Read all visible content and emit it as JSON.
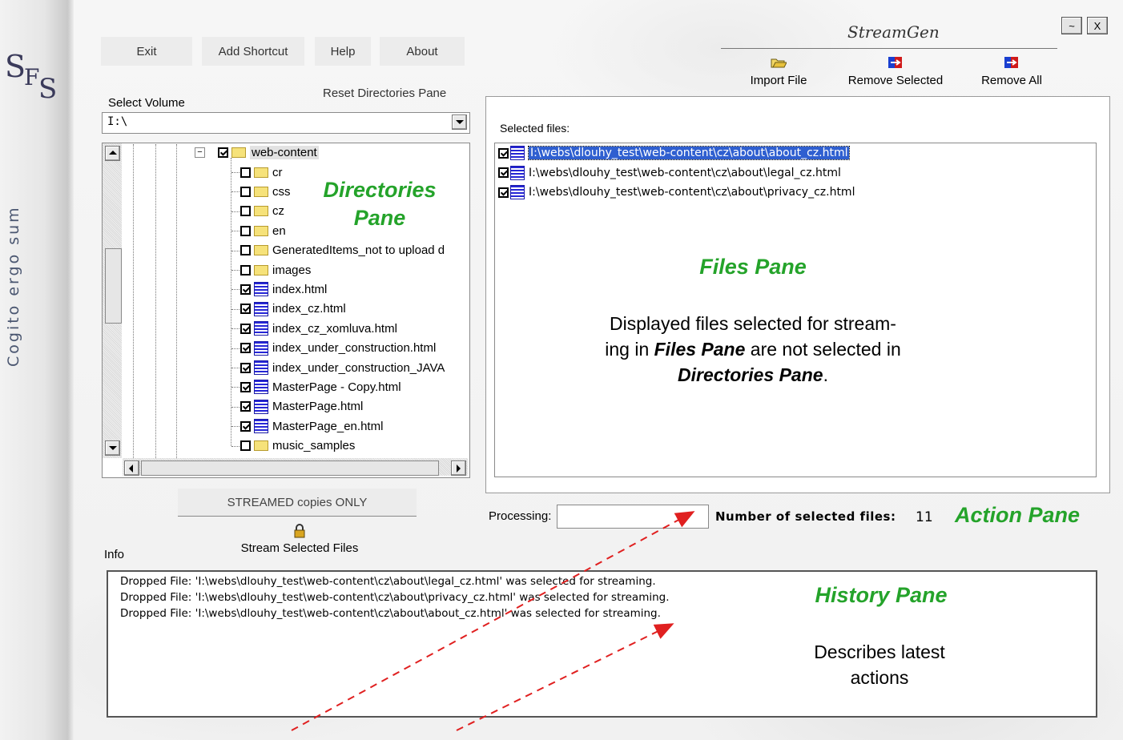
{
  "app": {
    "title": "StreamGen",
    "motto": "Cogito ergo sum"
  },
  "window_buttons": {
    "minimize": "~",
    "close": "X"
  },
  "menu": [
    {
      "label": "Exit"
    },
    {
      "label": "Add Shortcut"
    },
    {
      "label": "Help"
    },
    {
      "label": "About"
    }
  ],
  "toolbar": {
    "import_label": "Import File",
    "remove_selected_label": "Remove Selected",
    "remove_all_label": "Remove All"
  },
  "directories": {
    "reset_label": "Reset Directories Pane",
    "volume_label": "Select Volume",
    "volume_value": "I:\\",
    "root_folder": "web-content",
    "items": [
      {
        "name": "cr",
        "type": "folder",
        "checked": false
      },
      {
        "name": "css",
        "type": "folder",
        "checked": false
      },
      {
        "name": "cz",
        "type": "folder",
        "checked": false
      },
      {
        "name": "en",
        "type": "folder",
        "checked": false
      },
      {
        "name": "GeneratedItems_not to upload d",
        "type": "folder",
        "checked": false
      },
      {
        "name": "images",
        "type": "folder",
        "checked": false
      },
      {
        "name": "index.html",
        "type": "file",
        "checked": true
      },
      {
        "name": "index_cz.html",
        "type": "file",
        "checked": true
      },
      {
        "name": "index_cz_xomluva.html",
        "type": "file",
        "checked": true
      },
      {
        "name": "index_under_construction.html",
        "type": "file",
        "checked": true
      },
      {
        "name": "index_under_construction_JAVA",
        "type": "file",
        "checked": true
      },
      {
        "name": "MasterPage - Copy.html",
        "type": "file",
        "checked": true
      },
      {
        "name": "MasterPage.html",
        "type": "file",
        "checked": true
      },
      {
        "name": "MasterPage_en.html",
        "type": "file",
        "checked": true
      },
      {
        "name": "music_samples",
        "type": "folder",
        "checked": false
      }
    ]
  },
  "files": {
    "header": "Selected files:",
    "items": [
      {
        "path": "I:\\webs\\dlouhy_test\\web-content\\cz\\about\\about_cz.html",
        "checked": true,
        "selected": true
      },
      {
        "path": "I:\\webs\\dlouhy_test\\web-content\\cz\\about\\legal_cz.html",
        "checked": true,
        "selected": false
      },
      {
        "path": "I:\\webs\\dlouhy_test\\web-content\\cz\\about\\privacy_cz.html",
        "checked": true,
        "selected": false
      }
    ]
  },
  "action": {
    "streamed_only_label": "STREAMED copies ONLY",
    "stream_label": "Stream Selected Files",
    "processing_label": "Processing:",
    "processing_value": "",
    "count_label": "Number of selected files:",
    "count_value": "11"
  },
  "history": {
    "info_label": "Info",
    "lines": [
      "Dropped File:  'I:\\webs\\dlouhy_test\\web-content\\cz\\about\\legal_cz.html' was selected for streaming.",
      "Dropped File:  'I:\\webs\\dlouhy_test\\web-content\\cz\\about\\privacy_cz.html' was selected for streaming.",
      "Dropped File:  'I:\\webs\\dlouhy_test\\web-content\\cz\\about\\about_cz.html' was selected for streaming."
    ]
  },
  "annotations": {
    "directories_pane_1": "Directories",
    "directories_pane_2": "Pane",
    "files_pane": "Files Pane",
    "files_desc_1": "Displayed files selected for stream-",
    "files_desc_2a": "ing in ",
    "files_desc_2b": "Files Pane",
    "files_desc_2c": " are not selected in",
    "files_desc_3a": "Directories Pane",
    "files_desc_3b": ".",
    "action_pane": "Action Pane",
    "history_pane": "History Pane",
    "history_desc_1": "Describes latest",
    "history_desc_2": "actions"
  },
  "colors": {
    "annotation": "#24a32a",
    "selection": "#2f5fd0",
    "arrow": "#e02020"
  }
}
